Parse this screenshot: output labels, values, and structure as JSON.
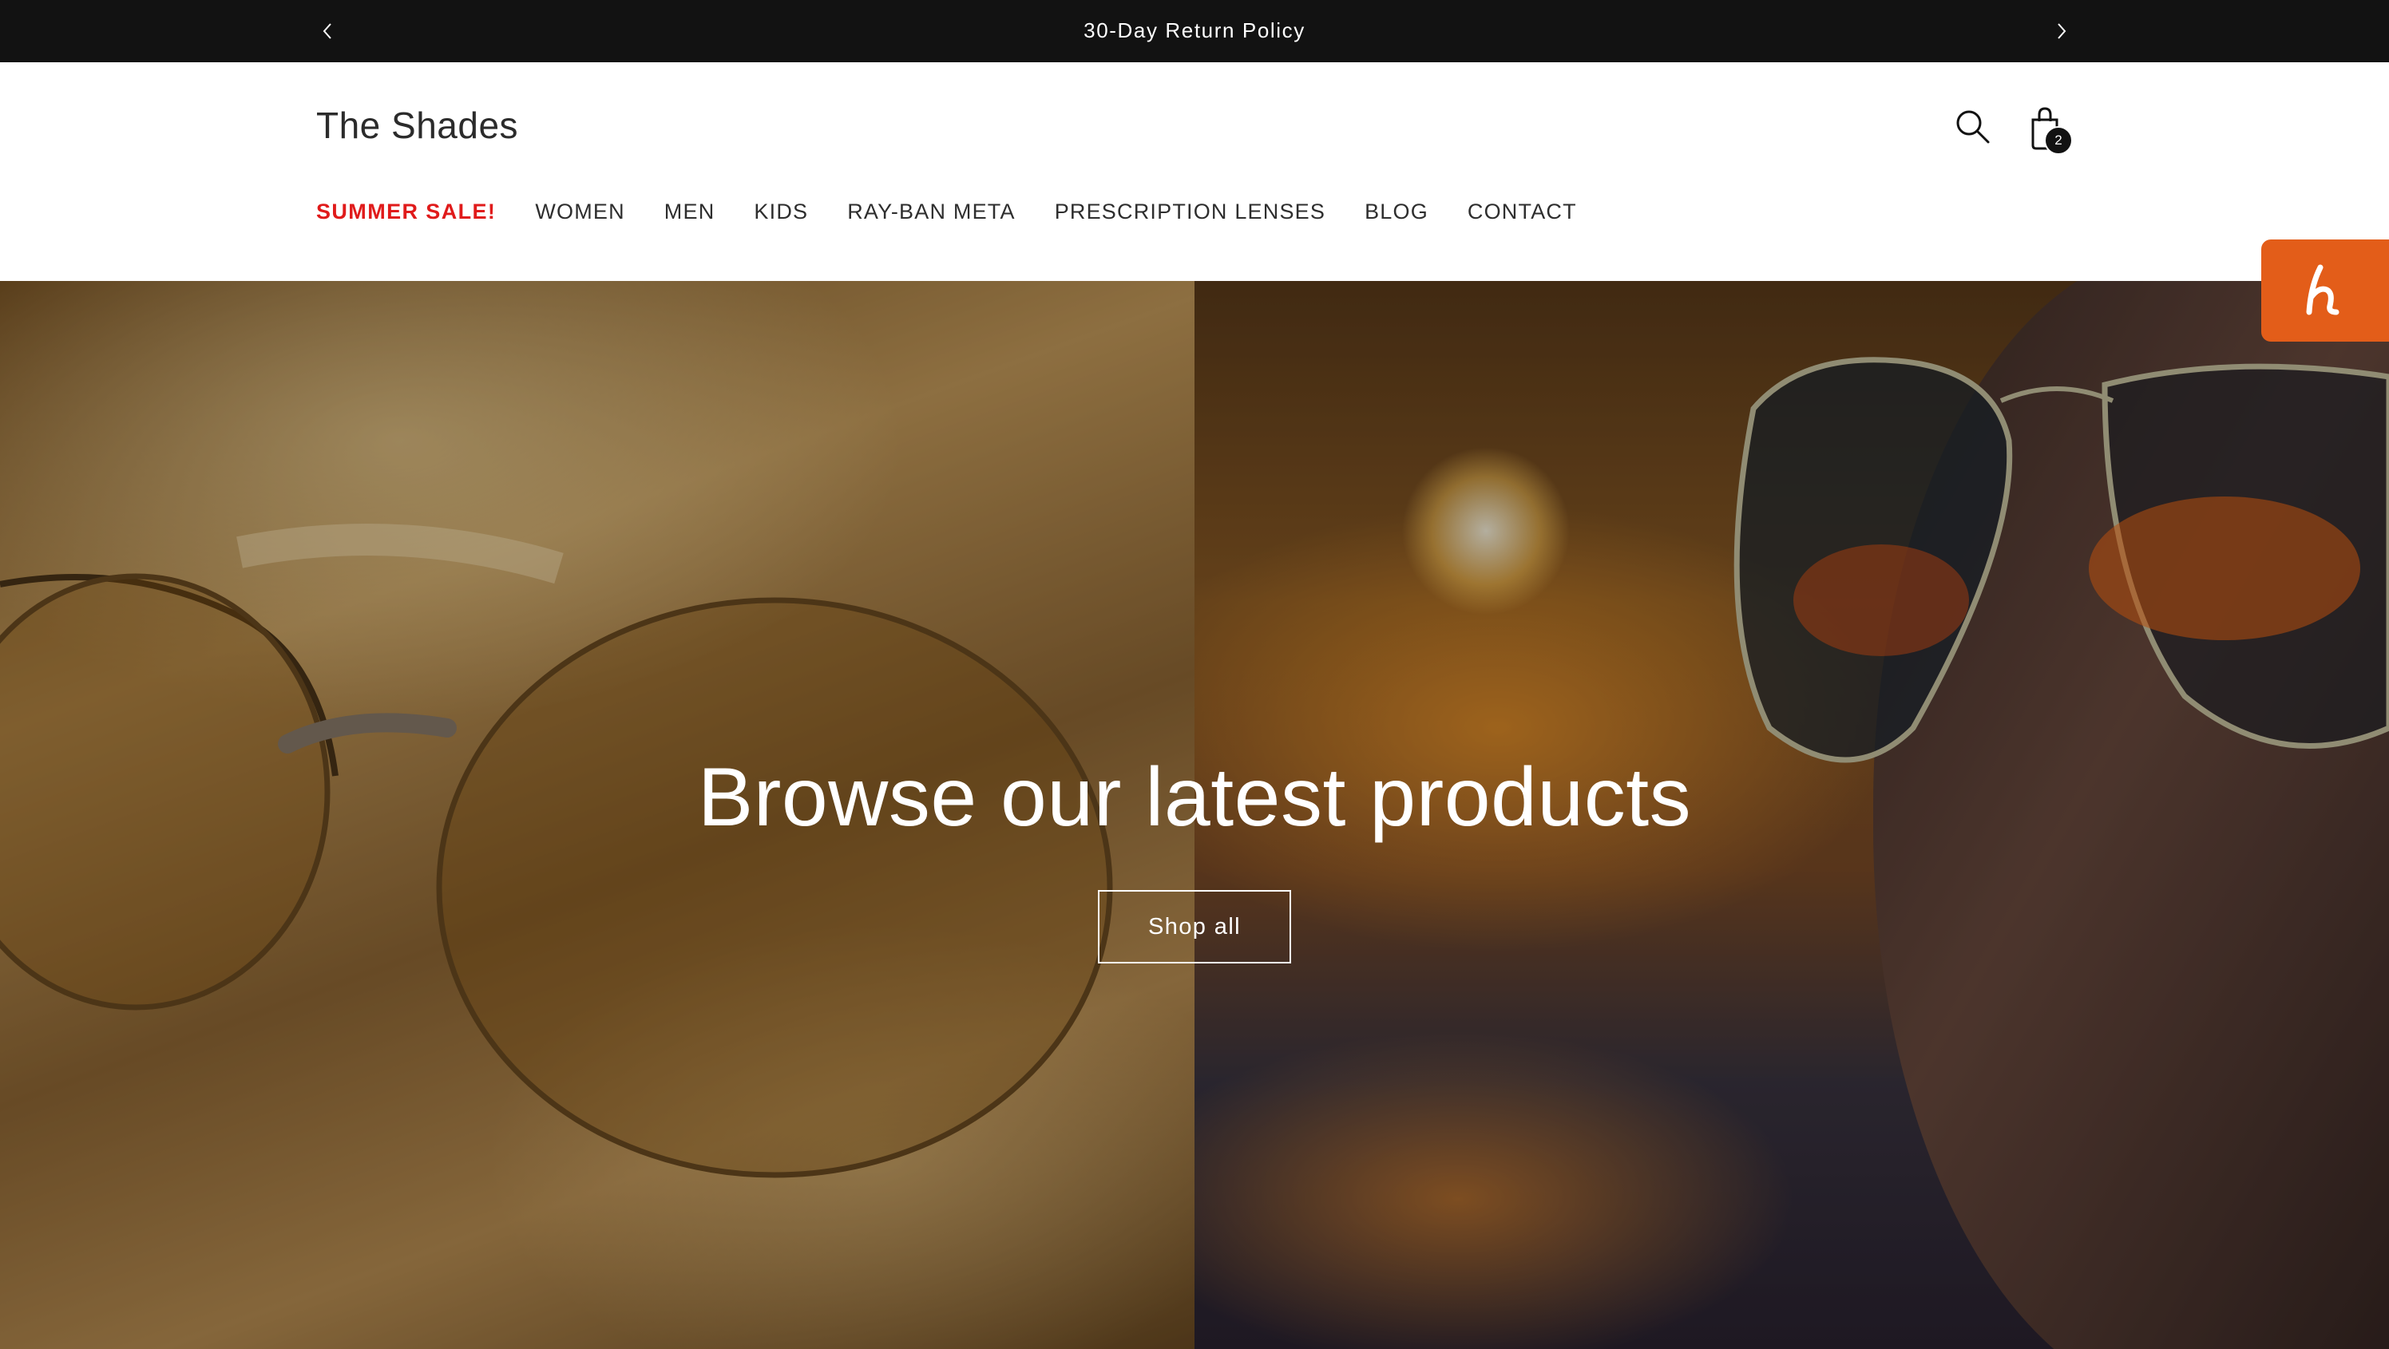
{
  "announcement": {
    "text": "30-Day Return Policy",
    "prev_icon": "chevron-left-icon",
    "next_icon": "chevron-right-icon"
  },
  "header": {
    "logo": "The Shades",
    "search_icon": "search-icon",
    "cart_icon": "shopping-bag-icon",
    "cart_count": "2"
  },
  "nav": {
    "items": [
      {
        "label": "SUMMER SALE!",
        "color": "#e01b1b"
      },
      {
        "label": "WOMEN"
      },
      {
        "label": "MEN"
      },
      {
        "label": "KIDS"
      },
      {
        "label": "RAY-BAN META"
      },
      {
        "label": "PRESCRIPTION LENSES"
      },
      {
        "label": "BLOG"
      },
      {
        "label": "CONTACT"
      }
    ]
  },
  "hero": {
    "title": "Browse our latest products",
    "button_label": "Shop all"
  },
  "widget": {
    "icon": "honey-logo-icon",
    "color": "#e35d19"
  }
}
